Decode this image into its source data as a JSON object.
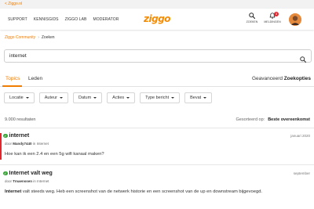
{
  "topbar": {
    "back_link": "< Ziggo.nl"
  },
  "nav": {
    "items": [
      "SUPPORT",
      "KENNISGIDS",
      "ZIGGO LAB",
      "MODERATOR"
    ]
  },
  "logo": {
    "text": "ziggo"
  },
  "header_actions": {
    "search_label": "ZOEKEN",
    "notifications_label": "MELDINGEN",
    "notifications_count": "3"
  },
  "breadcrumb": {
    "root": "Ziggo Community",
    "separator": "›",
    "current": "Zoeken"
  },
  "search": {
    "value": "internet"
  },
  "tabs": [
    {
      "label": "Topics"
    },
    {
      "label": "Leden"
    }
  ],
  "toolbar": {
    "advanced_label": "Geavanceerd",
    "options_label": "Zoekopties"
  },
  "filters": [
    "Locatie",
    "Auteur",
    "Datum",
    "Acties",
    "Type bericht",
    "Bevat"
  ],
  "results_summary": {
    "count_text": "9.000 resultaten",
    "sort_label": "Gesorteerd op:",
    "sort_value": "Beste overeenkomst"
  },
  "results": [
    {
      "title": "internet",
      "date": "januari 2020",
      "meta_prefix": "door",
      "author": "Mandy7440",
      "meta_in": "in",
      "location": "Internet",
      "body": "Hoe kan ik een 2.4 en een 5g wifi kanaal maken?",
      "body_bold": ""
    },
    {
      "title": "Internet valt weg",
      "date": "september",
      "meta_prefix": "door",
      "author": "Tmaenssen",
      "meta_in": "in",
      "location": "Internet",
      "body_bold": "Internet",
      "body": " valt steeds weg. Heb een screenshot van de netwerk historie en een screenshot van de up en downstream bijgevoegd."
    }
  ],
  "colors": {
    "brand": "#f07c00",
    "status_ok": "#3aa63a",
    "badge": "#e3262e",
    "accent_bar": "#e3262e"
  },
  "icons": {
    "search": "search-icon",
    "bell": "bell-icon",
    "check": "check-circle-icon",
    "caret": "caret-down-icon"
  }
}
